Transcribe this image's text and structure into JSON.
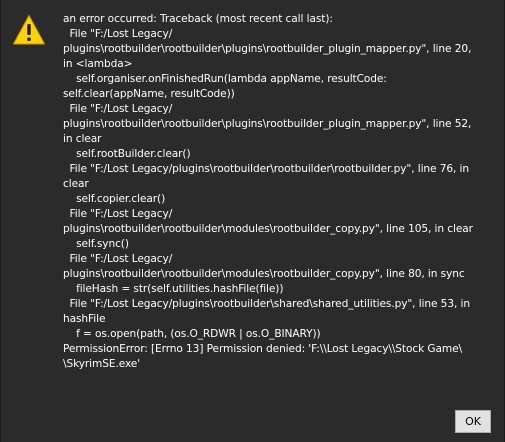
{
  "dialog": {
    "icon": "warning-triangle-icon",
    "icon_fill": "#ffd200",
    "message_lines": [
      "an error occurred: Traceback (most recent call last):",
      "  File \"F:/Lost Legacy/",
      "plugins\\rootbuilder\\rootbuilder\\plugins\\rootbuilder_plugin_mapper.py\", line 20,",
      "in <lambda>",
      "    self.organiser.onFinishedRun(lambda appName, resultCode:",
      "self.clear(appName, resultCode))",
      "  File \"F:/Lost Legacy/",
      "plugins\\rootbuilder\\rootbuilder\\plugins\\rootbuilder_plugin_mapper.py\", line 52,",
      "in clear",
      "    self.rootBuilder.clear()",
      "  File \"F:/Lost Legacy/plugins\\rootbuilder\\rootbuilder\\rootbuilder.py\", line 76, in",
      "clear",
      "    self.copier.clear()",
      "  File \"F:/Lost Legacy/",
      "plugins\\rootbuilder\\rootbuilder\\modules\\rootbuilder_copy.py\", line 105, in clear",
      "    self.sync()",
      "  File \"F:/Lost Legacy/",
      "plugins\\rootbuilder\\rootbuilder\\modules\\rootbuilder_copy.py\", line 80, in sync",
      "    fileHash = str(self.utilities.hashFile(file))",
      "  File \"F:/Lost Legacy/plugins\\rootbuilder\\shared\\shared_utilities.py\", line 53, in",
      "hashFile",
      "    f = os.open(path, (os.O_RDWR | os.O_BINARY))",
      "PermissionError: [Errno 13] Permission denied: 'F:\\\\Lost Legacy\\\\Stock Game\\",
      "\\SkyrimSE.exe'"
    ],
    "ok_label": "OK"
  }
}
